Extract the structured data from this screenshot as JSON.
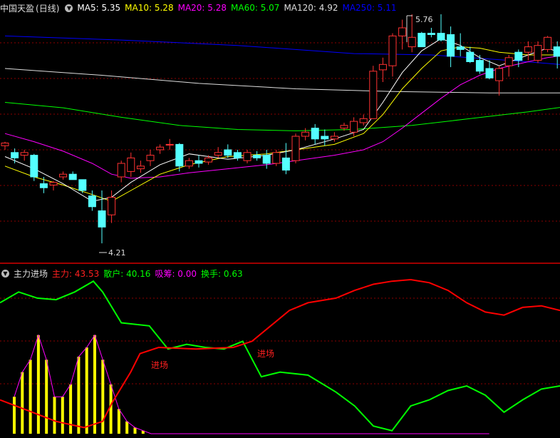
{
  "main_header": {
    "title": "中国天盈",
    "period": "(日线)",
    "indicators": [
      {
        "label": "MA5: 5.35",
        "color": "#ffffff"
      },
      {
        "label": "MA10: 5.28",
        "color": "#ffff00"
      },
      {
        "label": "MA20: 5.28",
        "color": "#ff00ff"
      },
      {
        "label": "MA60: 5.07",
        "color": "#00ff00"
      },
      {
        "label": "MA120: 4.92",
        "color": "#dddddd"
      },
      {
        "label": "MA250: 5.11",
        "color": "#0000ff"
      }
    ]
  },
  "price_annotations": {
    "high": "5.76",
    "low": "4.21"
  },
  "sub_header": {
    "title": "主力进场",
    "indicators": [
      {
        "label": "主力: 43.53",
        "color": "#ff2020"
      },
      {
        "label": "散户: 40.16",
        "color": "#00ff00"
      },
      {
        "label": "吸筹: 0.00",
        "color": "#ff00ff"
      },
      {
        "label": "换手: 0.63",
        "color": "#00ff00"
      }
    ]
  },
  "signal_labels": [
    "进场",
    "进场"
  ],
  "colors": {
    "up": "#ff3232",
    "down": "#54ffff",
    "grid": "#8b0000",
    "ma5": "#ffffff",
    "ma10": "#ffff00",
    "ma20": "#ff00ff",
    "ma60": "#00ff00",
    "ma120": "#dddddd",
    "ma250": "#0000ff",
    "main_force": "#ff0000",
    "retail": "#00ff00",
    "absorb": "#ff00ff",
    "absorb_bars": "#ffff00"
  },
  "chart_data": [
    {
      "type": "candlestick",
      "price_range": [
        4.1,
        5.9
      ],
      "ohlc": [
        [
          4.93,
          4.96,
          4.9,
          4.95
        ],
        [
          4.88,
          4.91,
          4.8,
          4.84
        ],
        [
          4.86,
          4.9,
          4.82,
          4.88
        ],
        [
          4.86,
          4.87,
          4.67,
          4.7
        ],
        [
          4.65,
          4.7,
          4.58,
          4.62
        ],
        [
          4.64,
          4.67,
          4.6,
          4.66
        ],
        [
          4.7,
          4.74,
          4.68,
          4.72
        ],
        [
          4.72,
          4.74,
          4.68,
          4.68
        ],
        [
          4.68,
          4.68,
          4.58,
          4.6
        ],
        [
          4.56,
          4.6,
          4.45,
          4.48
        ],
        [
          4.45,
          4.6,
          4.21,
          4.33
        ],
        [
          4.42,
          4.6,
          4.36,
          4.55
        ],
        [
          4.7,
          4.82,
          4.66,
          4.8
        ],
        [
          4.74,
          4.88,
          4.7,
          4.84
        ],
        [
          4.76,
          4.82,
          4.73,
          4.78
        ],
        [
          4.82,
          4.9,
          4.78,
          4.86
        ],
        [
          4.9,
          4.94,
          4.87,
          4.92
        ],
        [
          4.94,
          4.98,
          4.9,
          4.94
        ],
        [
          4.94,
          4.95,
          4.74,
          4.78
        ],
        [
          4.78,
          4.84,
          4.76,
          4.82
        ],
        [
          4.82,
          4.86,
          4.77,
          4.8
        ],
        [
          4.81,
          4.86,
          4.79,
          4.84
        ],
        [
          4.86,
          4.92,
          4.84,
          4.88
        ],
        [
          4.9,
          4.94,
          4.84,
          4.86
        ],
        [
          4.88,
          4.9,
          4.82,
          4.84
        ],
        [
          4.82,
          4.9,
          4.8,
          4.88
        ],
        [
          4.86,
          4.89,
          4.82,
          4.84
        ],
        [
          4.86,
          4.9,
          4.76,
          4.8
        ],
        [
          4.8,
          4.9,
          4.78,
          4.88
        ],
        [
          4.84,
          4.95,
          4.72,
          4.75
        ],
        [
          4.82,
          5.02,
          4.8,
          5.0
        ],
        [
          5.0,
          5.06,
          4.97,
          5.03
        ],
        [
          5.06,
          5.09,
          4.94,
          4.98
        ],
        [
          5.0,
          5.05,
          4.93,
          4.98
        ],
        [
          4.98,
          5.03,
          4.96,
          5.0
        ],
        [
          5.06,
          5.1,
          5.04,
          5.08
        ],
        [
          5.03,
          5.14,
          5.0,
          5.11
        ],
        [
          5.1,
          5.16,
          5.08,
          5.13
        ],
        [
          5.13,
          5.52,
          5.13,
          5.48
        ],
        [
          5.49,
          5.58,
          5.4,
          5.53
        ],
        [
          5.52,
          5.76,
          5.44,
          5.74
        ],
        [
          5.74,
          5.86,
          5.64,
          5.8
        ],
        [
          5.66,
          5.9,
          5.62,
          5.73
        ],
        [
          5.76,
          5.77,
          5.66,
          5.66
        ],
        [
          5.76,
          5.8,
          5.73,
          5.75
        ],
        [
          5.76,
          5.9,
          5.7,
          5.71
        ],
        [
          5.75,
          5.81,
          5.51,
          5.59
        ],
        [
          5.66,
          5.76,
          5.59,
          5.64
        ],
        [
          5.62,
          5.66,
          5.54,
          5.55
        ],
        [
          5.56,
          5.6,
          5.46,
          5.48
        ],
        [
          5.5,
          5.56,
          5.42,
          5.43
        ],
        [
          5.41,
          5.52,
          5.3,
          5.5
        ],
        [
          5.52,
          5.6,
          5.44,
          5.58
        ],
        [
          5.62,
          5.64,
          5.51,
          5.56
        ],
        [
          5.62,
          5.7,
          5.56,
          5.66
        ],
        [
          5.56,
          5.7,
          5.54,
          5.67
        ],
        [
          5.64,
          5.74,
          5.62,
          5.73
        ],
        [
          5.66,
          5.7,
          5.5,
          5.59
        ],
        [
          5.54,
          5.6,
          5.5,
          5.56
        ],
        [
          5.58,
          5.61,
          5.49,
          5.51
        ]
      ],
      "moving_averages": {
        "ma5": [
          [
            0,
            4.85
          ],
          [
            3,
            4.76
          ],
          [
            6,
            4.65
          ],
          [
            9,
            4.52
          ],
          [
            11,
            4.55
          ],
          [
            13,
            4.66
          ],
          [
            16,
            4.79
          ],
          [
            19,
            4.87
          ],
          [
            23,
            4.83
          ],
          [
            27,
            4.86
          ],
          [
            30,
            4.9
          ],
          [
            34,
            4.98
          ],
          [
            37,
            5.05
          ],
          [
            39,
            5.25
          ],
          [
            41,
            5.47
          ],
          [
            43,
            5.63
          ],
          [
            45,
            5.72
          ],
          [
            47,
            5.67
          ],
          [
            49,
            5.58
          ],
          [
            51,
            5.52
          ],
          [
            54,
            5.6
          ],
          [
            56,
            5.65
          ],
          [
            58,
            5.6
          ],
          [
            59,
            5.57
          ]
        ],
        "ma10": [
          [
            0,
            4.78
          ],
          [
            3,
            4.7
          ],
          [
            6,
            4.64
          ],
          [
            9,
            4.57
          ],
          [
            11,
            4.52
          ],
          [
            13,
            4.6
          ],
          [
            16,
            4.72
          ],
          [
            19,
            4.79
          ],
          [
            23,
            4.85
          ],
          [
            27,
            4.87
          ],
          [
            30,
            4.9
          ],
          [
            34,
            4.94
          ],
          [
            37,
            5.02
          ],
          [
            39,
            5.16
          ],
          [
            41,
            5.35
          ],
          [
            43,
            5.5
          ],
          [
            45,
            5.63
          ],
          [
            47,
            5.66
          ],
          [
            49,
            5.65
          ],
          [
            51,
            5.62
          ],
          [
            54,
            5.6
          ],
          [
            56,
            5.6
          ],
          [
            58,
            5.6
          ],
          [
            59,
            5.6
          ]
        ],
        "ma20": [
          [
            0,
            5.02
          ],
          [
            3,
            4.96
          ],
          [
            6,
            4.89
          ],
          [
            9,
            4.8
          ],
          [
            11,
            4.72
          ],
          [
            13,
            4.69
          ],
          [
            16,
            4.7
          ],
          [
            19,
            4.73
          ],
          [
            23,
            4.76
          ],
          [
            27,
            4.79
          ],
          [
            30,
            4.82
          ],
          [
            34,
            4.86
          ],
          [
            37,
            4.9
          ],
          [
            39,
            4.96
          ],
          [
            41,
            5.06
          ],
          [
            43,
            5.17
          ],
          [
            45,
            5.28
          ],
          [
            47,
            5.38
          ],
          [
            49,
            5.45
          ],
          [
            51,
            5.5
          ],
          [
            54,
            5.55
          ],
          [
            56,
            5.58
          ],
          [
            58,
            5.6
          ],
          [
            59,
            5.62
          ]
        ],
        "ma60": [
          [
            0,
            5.25
          ],
          [
            6,
            5.21
          ],
          [
            12,
            5.14
          ],
          [
            18,
            5.08
          ],
          [
            24,
            5.05
          ],
          [
            30,
            5.04
          ],
          [
            36,
            5.05
          ],
          [
            42,
            5.08
          ],
          [
            48,
            5.13
          ],
          [
            54,
            5.18
          ],
          [
            59,
            5.23
          ]
        ],
        "ma120": [
          [
            0,
            5.5
          ],
          [
            10,
            5.45
          ],
          [
            20,
            5.39
          ],
          [
            30,
            5.35
          ],
          [
            40,
            5.33
          ],
          [
            50,
            5.32
          ],
          [
            59,
            5.32
          ]
        ],
        "ma250": [
          [
            0,
            5.74
          ],
          [
            12,
            5.71
          ],
          [
            24,
            5.67
          ],
          [
            36,
            5.61
          ],
          [
            44,
            5.6
          ],
          [
            52,
            5.56
          ],
          [
            59,
            5.52
          ]
        ]
      }
    },
    {
      "type": "line",
      "value_range": [
        0,
        100
      ],
      "series": [
        {
          "name": "主力",
          "points": [
            [
              0,
              22
            ],
            [
              3,
              15
            ],
            [
              6,
              8
            ],
            [
              9,
              4
            ],
            [
              11,
              8
            ],
            [
              12,
              20
            ],
            [
              14,
              40
            ],
            [
              15,
              52
            ],
            [
              17,
              56
            ],
            [
              21,
              55
            ],
            [
              25,
              56
            ],
            [
              27,
              60
            ],
            [
              29,
              70
            ],
            [
              31,
              80
            ],
            [
              33,
              85
            ],
            [
              36,
              88
            ],
            [
              38,
              93
            ],
            [
              40,
              97
            ],
            [
              42,
              99
            ],
            [
              44,
              100
            ],
            [
              46,
              98
            ],
            [
              48,
              93
            ],
            [
              50,
              85
            ],
            [
              52,
              79
            ],
            [
              54,
              77
            ],
            [
              56,
              82
            ],
            [
              58,
              83
            ],
            [
              60,
              80
            ]
          ]
        },
        {
          "name": "散户",
          "points": [
            [
              0,
              85
            ],
            [
              2,
              92
            ],
            [
              4,
              88
            ],
            [
              6,
              87
            ],
            [
              8,
              92
            ],
            [
              10,
              99
            ],
            [
              11,
              92
            ],
            [
              13,
              72
            ],
            [
              16,
              70
            ],
            [
              18,
              55
            ],
            [
              20,
              58
            ],
            [
              22,
              56
            ],
            [
              24,
              55
            ],
            [
              26,
              60
            ],
            [
              28,
              37
            ],
            [
              30,
              40
            ],
            [
              33,
              38
            ],
            [
              36,
              27
            ],
            [
              38,
              18
            ],
            [
              40,
              5
            ],
            [
              42,
              2
            ],
            [
              44,
              18
            ],
            [
              46,
              22
            ],
            [
              48,
              28
            ],
            [
              50,
              31
            ],
            [
              52,
              25
            ],
            [
              54,
              14
            ],
            [
              56,
              22
            ],
            [
              58,
              29
            ],
            [
              60,
              31
            ]
          ]
        },
        {
          "name": "吸筹",
          "values": [
            24,
            40,
            48,
            64,
            48,
            24,
            24,
            32,
            50,
            56,
            64,
            48,
            32,
            16,
            8,
            4,
            2,
            0,
            0,
            0,
            0,
            0,
            0,
            0,
            0,
            0,
            0,
            0,
            0,
            0,
            0,
            0,
            0,
            0,
            0,
            0,
            0,
            0,
            0,
            0,
            0,
            0,
            0,
            0,
            0,
            0,
            0,
            0,
            0,
            0,
            0,
            0,
            0,
            0,
            0,
            0,
            0,
            0,
            0,
            0
          ]
        }
      ]
    }
  ]
}
